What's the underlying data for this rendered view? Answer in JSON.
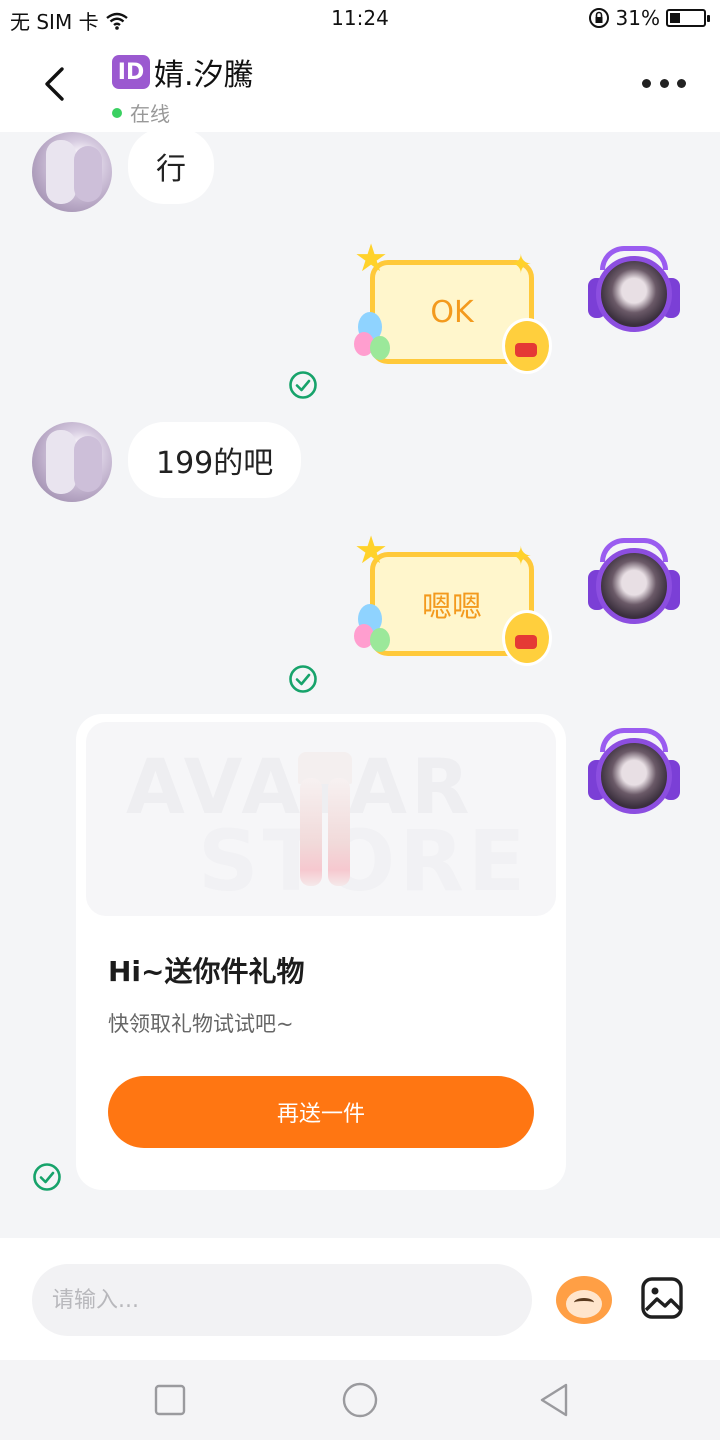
{
  "status_bar": {
    "carrier": "无 SIM 卡",
    "time": "11:24",
    "battery_pct": "31%",
    "battery_level": 0.31,
    "icons": [
      "wifi-icon",
      "rotation-lock-icon",
      "battery-icon"
    ]
  },
  "header": {
    "badge": "ID",
    "title": "婧.汐騰",
    "status": "在线",
    "status_color": "#3ad061"
  },
  "messages": [
    {
      "side": "left",
      "type": "text",
      "text": "行"
    },
    {
      "side": "right",
      "type": "sticker",
      "text": "OK",
      "read": true
    },
    {
      "side": "left",
      "type": "text",
      "text": "199的吧"
    },
    {
      "side": "right",
      "type": "sticker",
      "text": "嗯嗯",
      "read": true
    },
    {
      "side": "right",
      "type": "gift_card",
      "read": true
    }
  ],
  "gift_card": {
    "watermark_line1": "AVATAR",
    "watermark_line2": "STORE",
    "title": "Hi~送你件礼物",
    "subtitle": "快领取礼物试试吧~",
    "button": "再送一件",
    "button_color": "#ff7612"
  },
  "input_bar": {
    "placeholder": "请输入...",
    "icons": [
      "emoji-mascot-icon",
      "image-icon"
    ]
  },
  "nav_bar": {
    "icons": [
      "recents-square-icon",
      "home-circle-icon",
      "back-triangle-icon"
    ]
  },
  "colors": {
    "accent": "#ff7612",
    "read_check": "#17a36b",
    "sticker_text": "#f39a1e"
  }
}
